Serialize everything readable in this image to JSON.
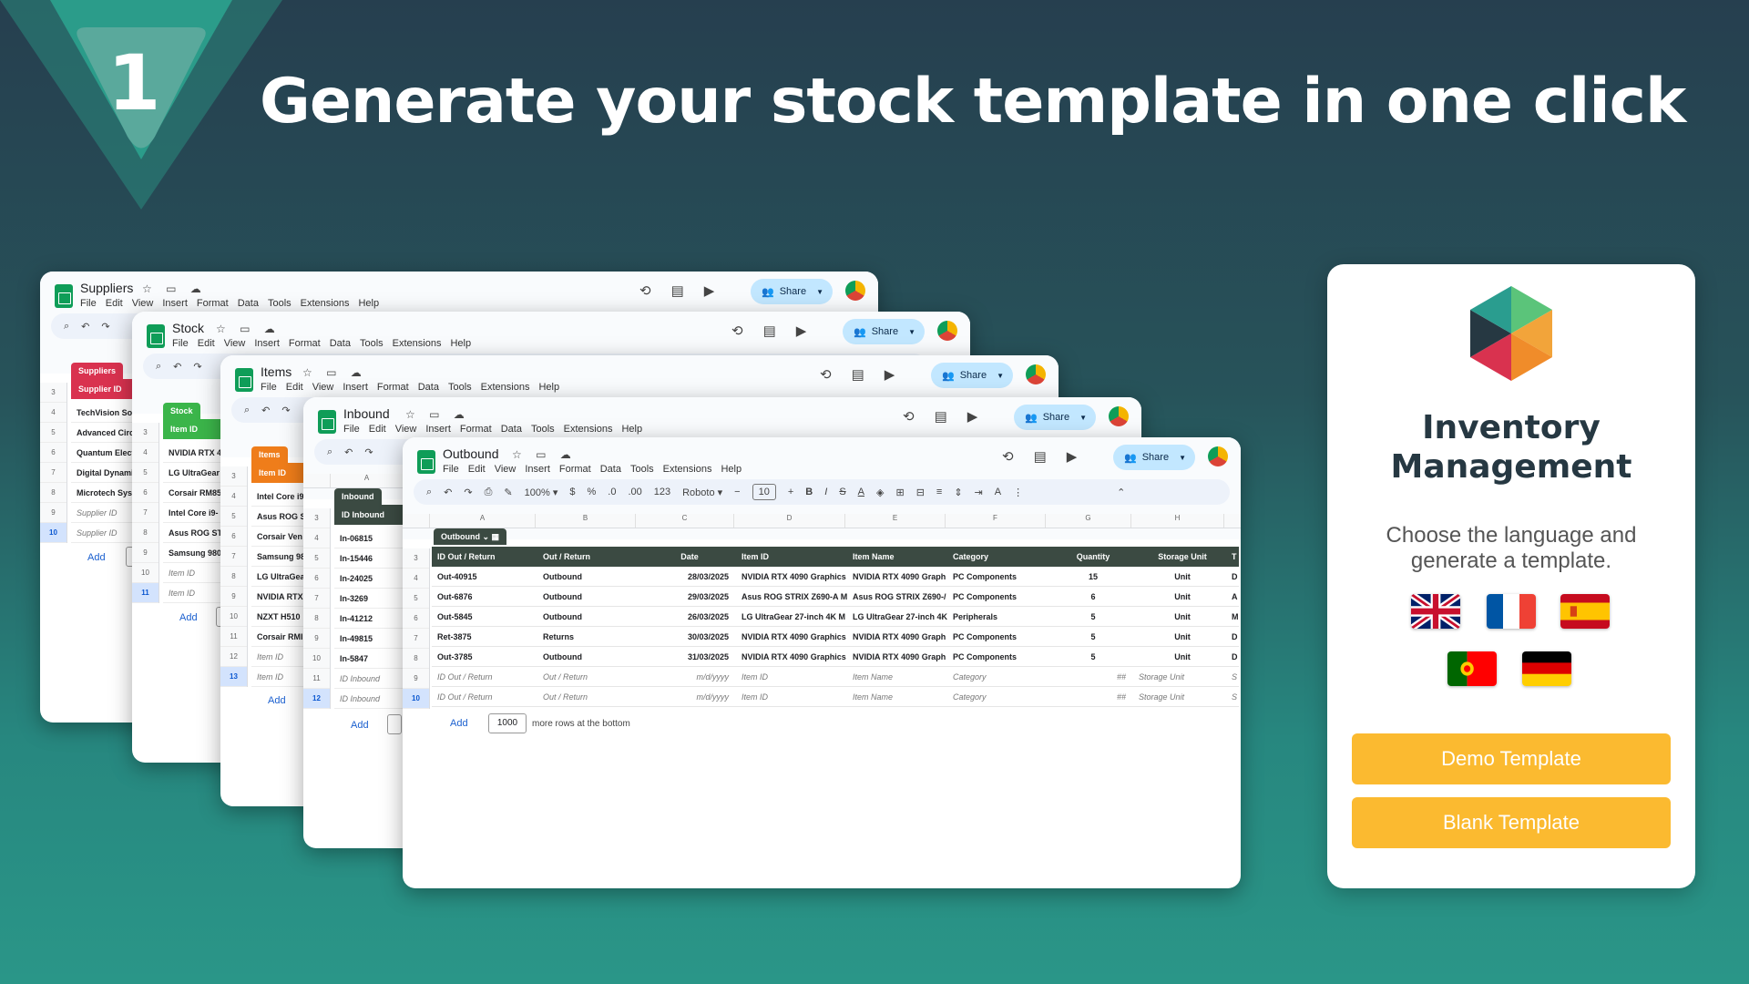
{
  "step_number": "1",
  "headline": "Generate your stock template in one click",
  "menu_items": [
    "File",
    "Edit",
    "View",
    "Insert",
    "Format",
    "Data",
    "Tools",
    "Extensions",
    "Help"
  ],
  "share_label": "Share",
  "windows": {
    "suppliers": {
      "title": "Suppliers",
      "table_name": "Suppliers",
      "column_header": "Supplier ID",
      "row_numbers": [
        "3",
        "4",
        "5",
        "6",
        "7",
        "8",
        "9",
        "10"
      ],
      "rows": [
        "TechVision So",
        "Advanced Circ",
        "Quantum Elect",
        "Digital Dynami",
        "Microtech Sys"
      ],
      "placeholders": [
        "Supplier ID",
        "Supplier ID"
      ],
      "add_label": "Add"
    },
    "stock": {
      "title": "Stock",
      "table_name": "Stock",
      "column_header": "Item ID",
      "row_numbers": [
        "3",
        "4",
        "5",
        "6",
        "7",
        "8",
        "9",
        "10",
        "11"
      ],
      "rows": [
        "NVIDIA RTX 4",
        "LG UltraGear",
        "Corsair RM85",
        "Intel Core i9-",
        "Asus ROG ST",
        "Samsung 980"
      ],
      "placeholders": [
        "Item ID",
        "Item ID"
      ],
      "add_label": "Add"
    },
    "items": {
      "title": "Items",
      "table_name": "Items",
      "column_header": "Item ID",
      "col_letter": "A",
      "row_numbers": [
        "3",
        "4",
        "5",
        "6",
        "7",
        "8",
        "9",
        "10",
        "11",
        "12",
        "13"
      ],
      "rows": [
        "Intel Core i9",
        "Asus ROG S",
        "Corsair Ven",
        "Samsung 98",
        "LG UltraGea",
        "NVIDIA RTX",
        "NZXT H510",
        "Corsair RMI"
      ],
      "placeholders": [
        "Item ID",
        "Item ID"
      ],
      "add_label": "Add"
    },
    "inbound": {
      "title": "Inbound",
      "table_name": "Inbound",
      "column_header": "ID Inbound",
      "col_letter": "A",
      "row_numbers": [
        "3",
        "4",
        "5",
        "6",
        "7",
        "8",
        "9",
        "10",
        "11",
        "12"
      ],
      "rows": [
        "In-06815",
        "In-15446",
        "In-24025",
        "In-3269",
        "In-41212",
        "In-49815",
        "In-5847"
      ],
      "placeholders": [
        "ID Inbound",
        "ID Inbound"
      ],
      "add_label": "Add"
    },
    "outbound": {
      "title": "Outbound",
      "table_name": "Outbound",
      "zoom": "100%",
      "font": "Roboto",
      "font_size": "10",
      "toolbar_currency": "$",
      "toolbar_percent": "%",
      "toolbar_decimal_less": ".0",
      "toolbar_decimal_more": ".00",
      "toolbar_number_format": "123",
      "col_letters": [
        "A",
        "B",
        "C",
        "D",
        "E",
        "F",
        "G",
        "H"
      ],
      "row_numbers": [
        "3",
        "4",
        "5",
        "6",
        "7",
        "8",
        "9",
        "10"
      ],
      "headers": [
        "ID Out / Return",
        "Out / Return",
        "Date",
        "Item ID",
        "Item Name",
        "Category",
        "Quantity",
        "Storage Unit",
        "T"
      ],
      "rows": [
        [
          "Out-40915",
          "Outbound",
          "28/03/2025",
          "NVIDIA RTX 4090 Graphics",
          "NVIDIA RTX 4090 Graph",
          "PC Components",
          "15",
          "Unit",
          "D"
        ],
        [
          "Out-6876",
          "Outbound",
          "29/03/2025",
          "Asus ROG STRIX Z690-A M",
          "Asus ROG STRIX Z690-/",
          "PC Components",
          "6",
          "Unit",
          "A"
        ],
        [
          "Out-5845",
          "Outbound",
          "26/03/2025",
          "LG UltraGear 27-inch 4K M",
          "LG UltraGear 27-inch 4K",
          "Peripherals",
          "5",
          "Unit",
          "M"
        ],
        [
          "Ret-3875",
          "Returns",
          "30/03/2025",
          "NVIDIA RTX 4090 Graphics",
          "NVIDIA RTX 4090 Graph",
          "PC Components",
          "5",
          "Unit",
          "D"
        ],
        [
          "Out-3785",
          "Outbound",
          "31/03/2025",
          "NVIDIA RTX 4090 Graphics",
          "NVIDIA RTX 4090 Graph",
          "PC Components",
          "5",
          "Unit",
          "D"
        ]
      ],
      "placeholder_row": [
        "ID Out / Return",
        "Out / Return",
        "m/d/yyyy",
        "Item ID",
        "Item Name",
        "Category",
        "##",
        "Storage Unit",
        "S"
      ],
      "add_label": "Add",
      "add_rows_value": "1000",
      "add_rows_suffix": "more rows at the bottom"
    }
  },
  "panel": {
    "title": "Inventory Management",
    "subtitle": "Choose the language and generate a template.",
    "flags": [
      "uk-flag",
      "france-flag",
      "spain-flag",
      "portugal-flag",
      "germany-flag"
    ],
    "demo_button": "Demo Template",
    "blank_button": "Blank Template"
  },
  "colors": {
    "suppliers": "#d9324f",
    "stock": "#3bb54a",
    "items": "#ef7d1a",
    "inbound": "#3b4a42",
    "outbound": "#3b4a42",
    "button": "#fbba30"
  }
}
